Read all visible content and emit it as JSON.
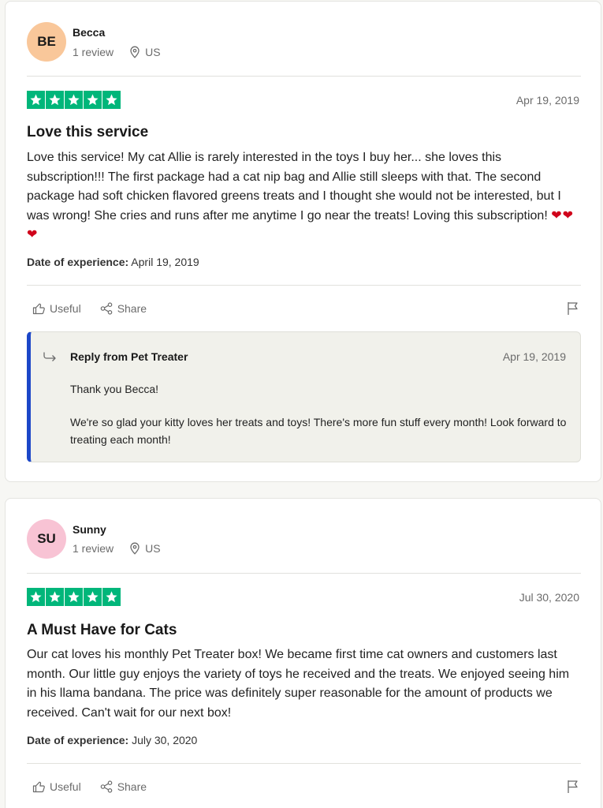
{
  "reviews": [
    {
      "initials": "BE",
      "avatar_color": "#f9c79a",
      "name": "Becca",
      "review_count": "1 review",
      "location": "US",
      "stars": 5,
      "date": "Apr 19, 2019",
      "title": "Love this service",
      "body": "Love this service! My cat Allie is rarely interested in the toys I buy her... she loves this subscription!!! The first package had a cat nip bag and Allie still sleeps with that. The second package had soft chicken flavored greens treats and I thought she would not be interested, but I was wrong! She cries and runs after me anytime I go near the treats! Loving this subscription!",
      "body_emoji": "❤❤❤",
      "experience_label": "Date of experience:",
      "experience_date": "April 19, 2019",
      "useful_label": "Useful",
      "share_label": "Share",
      "reply": {
        "from": "Reply from Pet Treater",
        "date": "Apr 19, 2019",
        "line1": "Thank you Becca!",
        "line2": "We're so glad your kitty loves her treats and toys! There's more fun stuff every month! Look forward to treating each month!"
      }
    },
    {
      "initials": "SU",
      "avatar_color": "#f8c3d4",
      "name": "Sunny",
      "review_count": "1 review",
      "location": "US",
      "stars": 5,
      "date": "Jul 30, 2020",
      "title": "A Must Have for Cats",
      "body": "Our cat loves his monthly Pet Treater box! We became first time cat owners and customers last month. Our little guy enjoys the variety of toys he received and the treats. We enjoyed seeing him in his llama bandana. The price was definitely super reasonable for the amount of products we received. Can't wait for our next box!",
      "experience_label": "Date of experience:",
      "experience_date": "July 30, 2020",
      "useful_label": "Useful",
      "share_label": "Share"
    }
  ],
  "colors": {
    "star_green": "#00b67a",
    "reply_accent": "#1c47c8"
  },
  "icons": {
    "location": "map-pin-icon",
    "useful": "thumbs-up-icon",
    "share": "share-icon",
    "flag": "flag-icon",
    "reply": "reply-arrow-icon",
    "star": "star-icon"
  }
}
